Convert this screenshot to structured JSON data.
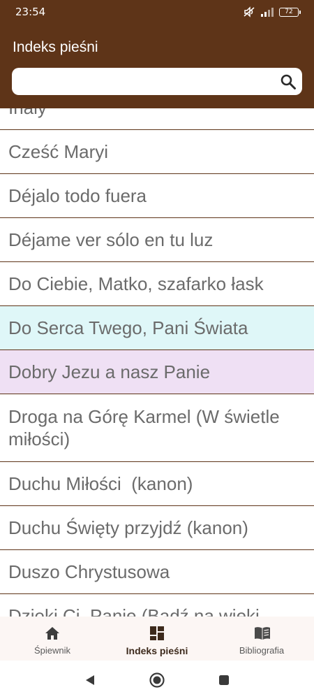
{
  "status_bar": {
    "time": "23:54",
    "battery": "72",
    "icons": [
      "mute-icon",
      "signal-icon",
      "battery-icon"
    ]
  },
  "app_bar": {
    "title": "Indeks pieśni",
    "search": {
      "value": "",
      "placeholder": ""
    },
    "colors": {
      "primary": "#5e3418"
    }
  },
  "songs": {
    "item0": "Inaly",
    "item1": "Cześć Maryi",
    "item2": "Déjalo todo fuera",
    "item3": "Déjame ver sólo en tu luz",
    "item4": "Do Ciebie, Matko, szafarko łask",
    "item5": "Do Serca Twego, Pani Świata",
    "item6": "Dobry Jezu a nasz Panie",
    "item7": "Droga na Górę Karmel (W świetle miłości)",
    "item8": "Duchu Miłości  (kanon)",
    "item9": "Duchu Święty przyjdź (kanon)",
    "item10": "Duszo Chrystusowa",
    "item11": "Dzięki Ci, Panie (Bądź na wieki"
  },
  "bottom_nav": {
    "spiewnik": "Śpiewnik",
    "indeks": "Indeks pieśni",
    "bibliografia": "Bibliografia",
    "active": "Indeks pieśni"
  }
}
